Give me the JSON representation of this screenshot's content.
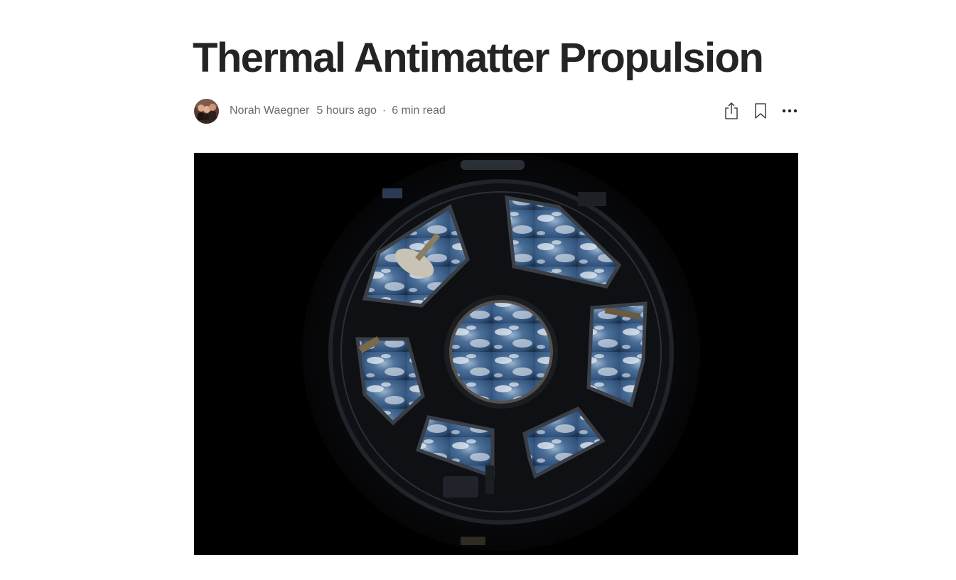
{
  "article": {
    "title": "Thermal Antimatter Propulsion",
    "author": "Norah Waegner",
    "published": "5 hours ago",
    "separator": "·",
    "read_time": "6 min read"
  },
  "icons": {
    "share": "share-icon",
    "bookmark": "bookmark-icon",
    "more": "more-icon"
  },
  "hero_image": {
    "subject": "cupola-window-view-of-earth"
  },
  "colors": {
    "title": "#242424",
    "meta": "#6b6b6b",
    "hero_background": "#000000"
  }
}
